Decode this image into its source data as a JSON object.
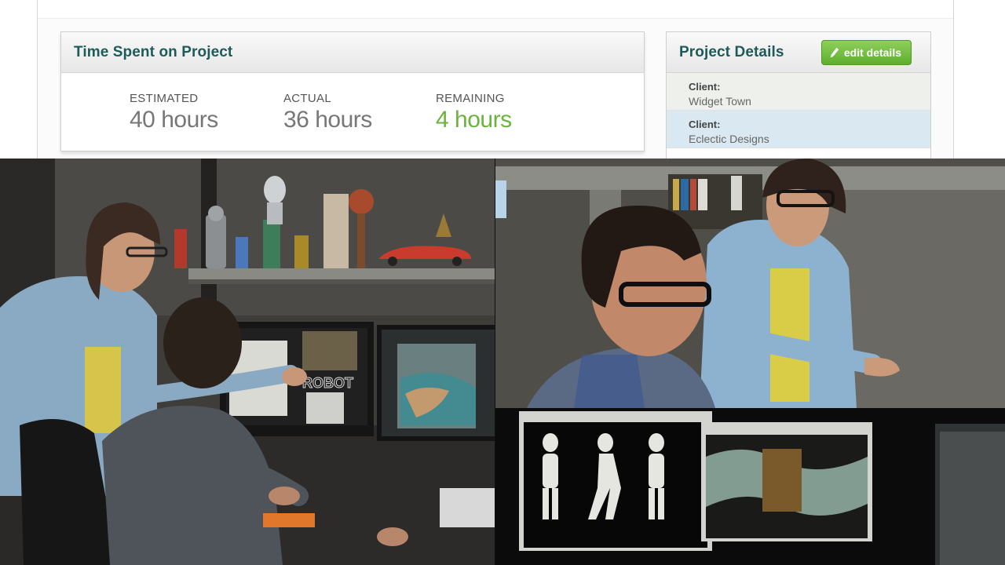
{
  "time_panel": {
    "title": "Time Spent on Project",
    "estimated": {
      "label": "ESTIMATED",
      "value": "40 hours"
    },
    "actual": {
      "label": "ACTUAL",
      "value": "36 hours"
    },
    "remaining": {
      "label": "REMAINING",
      "value": "4 hours"
    }
  },
  "details_panel": {
    "title": "Project Details",
    "edit_label": "edit details",
    "clients": [
      {
        "label": "Client:",
        "name": "Widget Town"
      },
      {
        "label": "Client:",
        "name": "Eclectic Designs"
      }
    ]
  },
  "scene": {
    "monitor_text": "ROBOT"
  },
  "colors": {
    "title_teal": "#1d5a5a",
    "remaining_green": "#6ab33d",
    "button_green": "#6dbb3a",
    "selected_row": "#d9e8f1"
  }
}
